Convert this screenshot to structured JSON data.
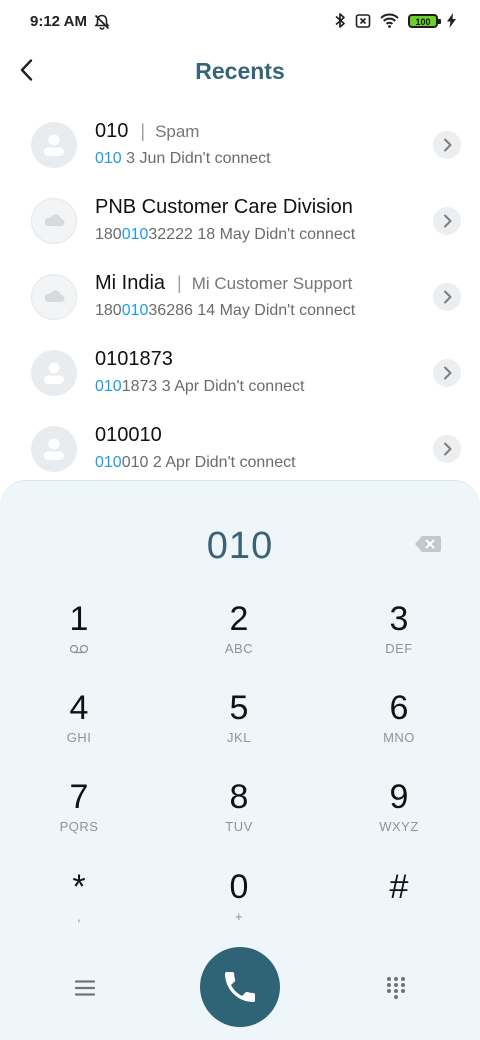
{
  "status": {
    "time": "9:12 AM",
    "battery": "100"
  },
  "header": {
    "title": "Recents"
  },
  "recents": [
    {
      "name": "010",
      "label": "Spam",
      "sub_hl": "010",
      "sub_rest": " 3 Jun Didn't connect",
      "avatar": "person"
    },
    {
      "name": "PNB Customer Care Division",
      "num_pre": "180",
      "sub_hl": "010",
      "num_post": "32222",
      "sub_rest": " 18 May Didn't connect",
      "avatar": "cloud"
    },
    {
      "name": "Mi India",
      "label": "Mi Customer Support",
      "num_pre": "180",
      "sub_hl": "010",
      "num_post": "36286",
      "sub_rest": " 14 May Didn't connect",
      "avatar": "cloud"
    },
    {
      "name": "0101873",
      "sub_hl": "010",
      "num_post": "1873",
      "sub_rest": " 3 Apr Didn't connect",
      "avatar": "person"
    },
    {
      "name": "010010",
      "sub_hl": "010",
      "num_post": "010",
      "sub_rest": " 2 Apr Didn't connect",
      "avatar": "person"
    }
  ],
  "dialer": {
    "number": "010",
    "keys": [
      {
        "d": "1",
        "l": ""
      },
      {
        "d": "2",
        "l": "ABC"
      },
      {
        "d": "3",
        "l": "DEF"
      },
      {
        "d": "4",
        "l": "GHI"
      },
      {
        "d": "5",
        "l": "JKL"
      },
      {
        "d": "6",
        "l": "MNO"
      },
      {
        "d": "7",
        "l": "PQRS"
      },
      {
        "d": "8",
        "l": "TUV"
      },
      {
        "d": "9",
        "l": "WXYZ"
      },
      {
        "d": "*",
        "l": ","
      },
      {
        "d": "0",
        "l": "+"
      },
      {
        "d": "#",
        "l": ""
      }
    ]
  },
  "colors": {
    "accent": "#346578",
    "highlight": "#1e9ee0",
    "call": "#2e6476",
    "pad_bg": "#eef6fa"
  }
}
